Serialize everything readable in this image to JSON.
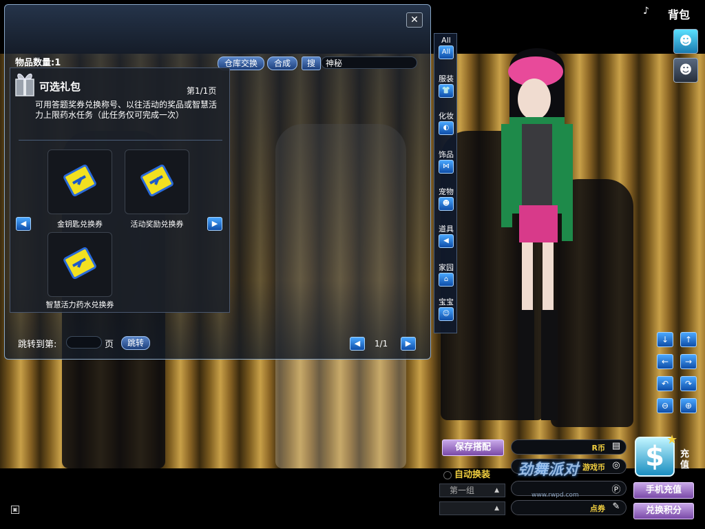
{
  "header": {
    "backpack_title": "背包"
  },
  "toolbar": {
    "item_count": "物品数量:1",
    "warehouse_exchange": "仓库交换",
    "combine": "合成",
    "search_label": "搜",
    "search_value": "神秘"
  },
  "gift": {
    "title": "可选礼包",
    "page": "第1/1页",
    "description": "可用答题奖券兑换称号、以往活动的奖品或智慧活力上限药水任务（此任务仅可完成一次）",
    "items": [
      {
        "label": "金钥匙兑换券"
      },
      {
        "label": "活动奖励兑换券"
      },
      {
        "label": "智慧活力药水兑换券"
      }
    ]
  },
  "footer": {
    "jump_label": "跳转到第:",
    "jump_unit": "页",
    "jump_button": "跳转",
    "page_count": "1/1"
  },
  "categories": [
    {
      "label": "All",
      "icon": "All"
    },
    {
      "label": "服装",
      "icon": "shirt-icon"
    },
    {
      "label": "化妆",
      "icon": "makeup-icon"
    },
    {
      "label": "饰品",
      "icon": "bow-icon"
    },
    {
      "label": "宠物",
      "icon": "pet-icon"
    },
    {
      "label": "道具",
      "icon": "megaphone-icon"
    },
    {
      "label": "家园",
      "icon": "house-icon"
    },
    {
      "label": "宝宝",
      "icon": "baby-icon"
    }
  ],
  "outfit": {
    "save_label": "保存搭配",
    "auto_dress": "自动换装",
    "group_select": "第一组",
    "group_select_2": ""
  },
  "currency": {
    "r_coin": "R币",
    "game_coin": "游戏币",
    "p_points": "",
    "coupon": "点券"
  },
  "recharge": {
    "label": "充值",
    "symbol": "$",
    "mobile_recharge": "手机充值",
    "exchange_points": "兑换积分"
  },
  "watermark": {
    "logo_text": "劲舞派对",
    "url": "www.rwpd.com"
  },
  "colors": {
    "accent_blue": "#1e6ed8",
    "gold": "#f2d040",
    "purple_button": "#9a6ac8"
  }
}
